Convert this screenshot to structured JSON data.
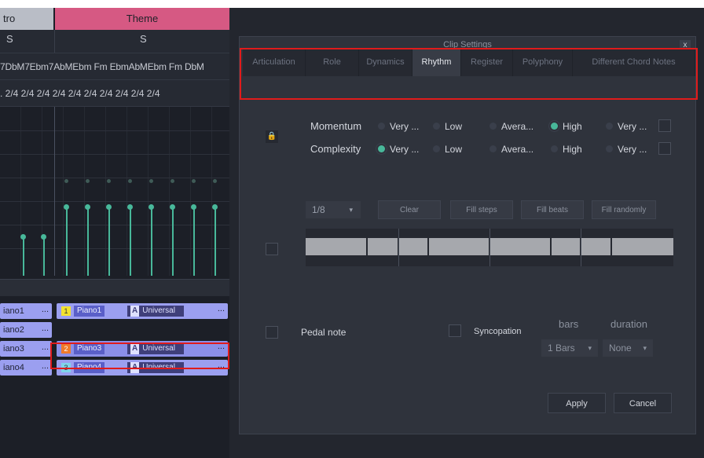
{
  "editor": {
    "sections": {
      "intro": "tro",
      "theme": "Theme"
    },
    "s_marks": [
      "S",
      "S"
    ],
    "chords_row": "7DbM7Ebm7AbMEbm Fm EbmAbMEbm Fm DbM",
    "timesig_row": ". 2/4 2/4 2/4 2/4 2/4 2/4 2/4 2/4 2/4 2/4",
    "tracks": [
      {
        "left_label": "iano1",
        "left_dots": "...",
        "badge": "1",
        "badge_color": "#f2e12f",
        "clip_name": "Piano1",
        "univ_letter": "A",
        "univ_label": "Universal",
        "dots": "..."
      },
      {
        "left_label": "iano2",
        "left_dots": "..."
      },
      {
        "left_label": "iano3",
        "left_dots": "...",
        "badge": "2",
        "badge_color": "#f07a2a",
        "clip_name": "Piano3",
        "univ_letter": "A",
        "univ_label": "Universal",
        "dots": "..."
      },
      {
        "left_label": "iano4",
        "left_dots": "...",
        "badge": "3",
        "badge_color": "#7fd4ea",
        "clip_name": "Piano4",
        "univ_letter": "A",
        "univ_label": "Universal",
        "dots": "..."
      }
    ]
  },
  "dialog": {
    "title": "Clip Settings",
    "close": "x",
    "tabs": [
      "Articulation",
      "Role",
      "Dynamics",
      "Rhythm",
      "Register",
      "Polyphony",
      "Different Chord Notes"
    ],
    "active_tab": "Rhythm",
    "lock_icon": "lock-icon",
    "momentum": {
      "label": "Momentum",
      "options": [
        "Very ...",
        "Low",
        "Avera...",
        "High",
        "Very ..."
      ],
      "selected": "High"
    },
    "complexity": {
      "label": "Complexity",
      "options": [
        "Very ...",
        "Low",
        "Avera...",
        "High",
        "Very ..."
      ],
      "selected_index": 0
    },
    "step_dropdown": "1/8",
    "step_dropdown_caret": "▾",
    "buttons": {
      "clear": "Clear",
      "fill_steps": "Fill steps",
      "fill_beats": "Fill beats",
      "fill_randomly": "Fill randomly"
    },
    "pedal_note": "Pedal note",
    "syncopation": "Syncopation",
    "bars_header": "bars",
    "duration_header": "duration",
    "bars_value": "1 Bars",
    "duration_value": "None",
    "apply": "Apply",
    "cancel": "Cancel"
  },
  "colors": {
    "accent": "#48b89a",
    "theme_section": "#d65983",
    "clip": "#9b9ff0",
    "highlight": "#e01b1b"
  }
}
